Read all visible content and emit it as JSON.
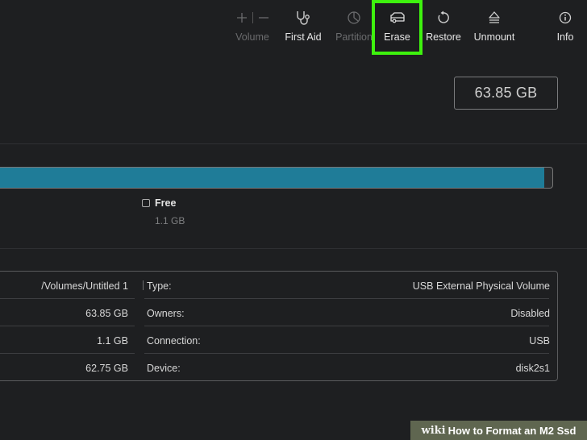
{
  "toolbar": {
    "volume": {
      "plus_icon": "plus-icon",
      "minus_icon": "minus-icon",
      "label": "Volume",
      "enabled": false
    },
    "first_aid": {
      "icon": "stethoscope-icon",
      "label": "First Aid",
      "enabled": true
    },
    "partition": {
      "icon": "partition-pie-icon",
      "label": "Partition",
      "enabled": false
    },
    "erase": {
      "icon": "eraser-icon",
      "label": "Erase",
      "enabled": true,
      "highlighted": true
    },
    "restore": {
      "icon": "restore-arrow-icon",
      "label": "Restore",
      "enabled": true
    },
    "unmount": {
      "icon": "eject-icon",
      "label": "Unmount",
      "enabled": true
    },
    "info": {
      "icon": "info-icon",
      "label": "Info",
      "enabled": true
    }
  },
  "capacity": "63.85 GB",
  "usage": {
    "used_fraction": 0.985,
    "color": "#1f7c98"
  },
  "legend": {
    "title": "Free",
    "size": "1.1 GB"
  },
  "details": {
    "left": [
      "/Volumes/Untitled 1",
      "63.85 GB",
      "1.1 GB",
      "62.75 GB"
    ],
    "right": [
      {
        "label": "Type:",
        "value": "USB External Physical Volume"
      },
      {
        "label": "Owners:",
        "value": "Disabled"
      },
      {
        "label": "Connection:",
        "value": "USB"
      },
      {
        "label": "Device:",
        "value": "disk2s1"
      }
    ]
  },
  "highlight_color": "#3ef20e",
  "watermark": {
    "wiki": "wiki",
    "text": "How to Format an M2 Ssd"
  }
}
